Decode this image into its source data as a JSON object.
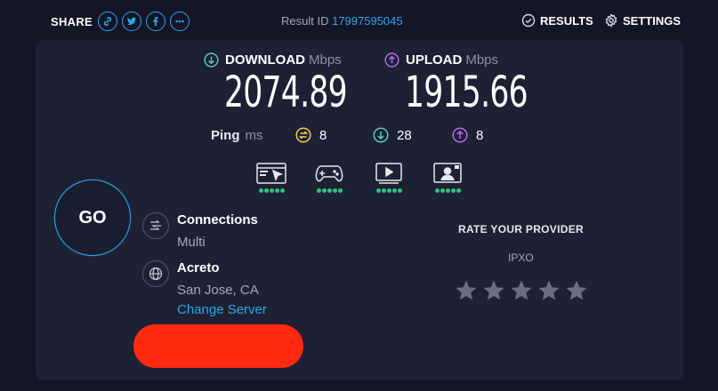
{
  "top": {
    "share_label": "SHARE",
    "share_buttons": [
      "link",
      "twitter",
      "facebook",
      "more"
    ],
    "result_id_label": "Result ID",
    "result_id_value": "17997595045",
    "results_label": "RESULTS",
    "settings_label": "SETTINGS"
  },
  "speed": {
    "download_label": "DOWNLOAD",
    "upload_label": "UPLOAD",
    "unit": "Mbps",
    "download_value": "2074.89",
    "upload_value": "1915.66"
  },
  "ping": {
    "label": "Ping",
    "unit": "ms",
    "idle": "8",
    "download": "28",
    "upload": "8"
  },
  "performance": [
    {
      "name": "web-browsing-icon",
      "rating": 5
    },
    {
      "name": "gaming-icon",
      "rating": 5
    },
    {
      "name": "video-streaming-icon",
      "rating": 5
    },
    {
      "name": "video-chat-icon",
      "rating": 5
    }
  ],
  "go_label": "GO",
  "connections": {
    "title": "Connections",
    "value": "Multi"
  },
  "server": {
    "title": "Acreto",
    "location": "San Jose, CA",
    "change_label": "Change Server"
  },
  "rate": {
    "title": "RATE YOUR PROVIDER",
    "provider": "IPXO",
    "stars": 5
  },
  "colors": {
    "accent": "#2aa8e8",
    "download": "#4fd1c5",
    "upload": "#b56cf0",
    "idle": "#f2d14a",
    "good": "#2ec27e",
    "redacted": "#ff2a10"
  }
}
